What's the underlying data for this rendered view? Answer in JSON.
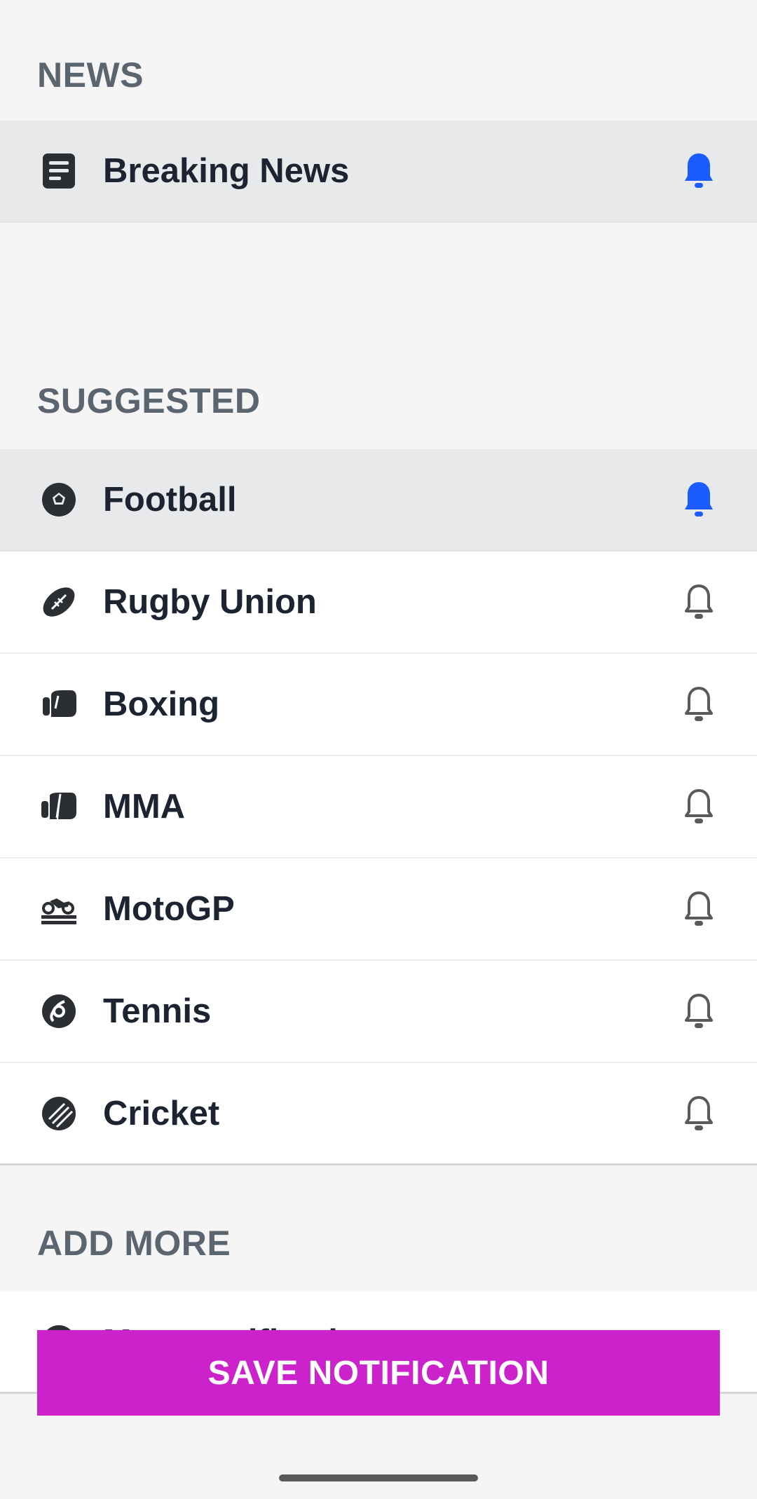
{
  "sections": {
    "news_title": "NEWS",
    "suggested_title": "SUGGESTED",
    "add_more_title": "ADD MORE"
  },
  "news_items": [
    {
      "label": "Breaking News",
      "icon": "article-icon",
      "notifications_on": true
    }
  ],
  "suggested_items": [
    {
      "label": "Football",
      "icon": "football-icon",
      "notifications_on": true
    },
    {
      "label": "Rugby Union",
      "icon": "rugby-ball-icon",
      "notifications_on": false
    },
    {
      "label": "Boxing",
      "icon": "boxing-glove-icon",
      "notifications_on": false
    },
    {
      "label": "MMA",
      "icon": "mma-glove-icon",
      "notifications_on": false
    },
    {
      "label": "MotoGP",
      "icon": "motorbike-icon",
      "notifications_on": false
    },
    {
      "label": "Tennis",
      "icon": "tennis-ball-icon",
      "notifications_on": false
    },
    {
      "label": "Cricket",
      "icon": "cricket-ball-icon",
      "notifications_on": false
    }
  ],
  "add_more": {
    "label": "More notifications",
    "icon": "add-circle-icon"
  },
  "save_button": {
    "label": "SAVE NOTIFICATION"
  },
  "colors": {
    "accent": "#1a5cff",
    "save_button": "#cc22cc",
    "bell_off": "#5a5a5a"
  }
}
